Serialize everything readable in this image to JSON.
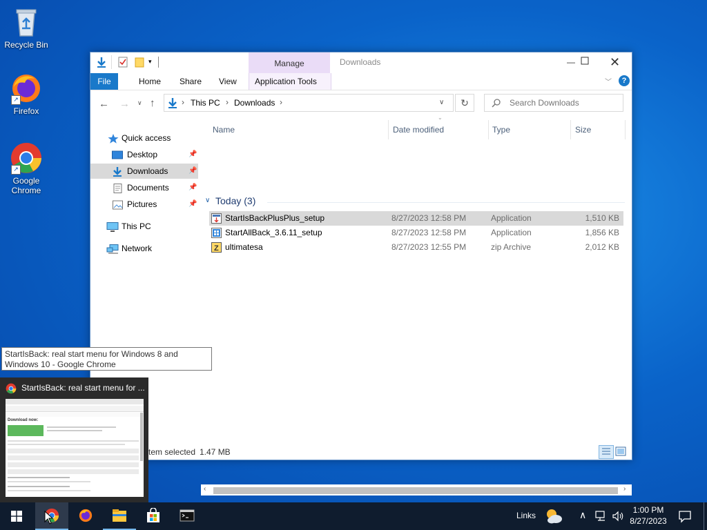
{
  "desktop": {
    "icons": [
      {
        "label": "Recycle Bin"
      },
      {
        "label": "Firefox"
      },
      {
        "label": "Google Chrome"
      }
    ]
  },
  "explorer": {
    "title": "Downloads",
    "ribbon": {
      "file": "File",
      "home": "Home",
      "share": "Share",
      "view": "View",
      "contextual_group": "Manage",
      "contextual_tab": "Application Tools"
    },
    "address": {
      "crumbs": [
        "This PC",
        "Downloads"
      ],
      "search_placeholder": "Search Downloads"
    },
    "nav": {
      "quick_access": "Quick access",
      "items": [
        {
          "label": "Desktop",
          "pinned": true
        },
        {
          "label": "Downloads",
          "pinned": true
        },
        {
          "label": "Documents",
          "pinned": true
        },
        {
          "label": "Pictures",
          "pinned": true
        }
      ],
      "this_pc": "This PC",
      "network": "Network"
    },
    "columns": [
      "Name",
      "Date modified",
      "Type",
      "Size"
    ],
    "group": "Today (3)",
    "files": [
      {
        "name": "StartIsBackPlusPlus_setup",
        "date": "8/27/2023 12:58 PM",
        "type": "Application",
        "size": "1,510 KB",
        "selected": true
      },
      {
        "name": "StartAllBack_3.6.11_setup",
        "date": "8/27/2023 12:58 PM",
        "type": "Application",
        "size": "1,856 KB",
        "selected": false
      },
      {
        "name": "ultimatesa",
        "date": "8/27/2023 12:55 PM",
        "type": "zip Archive",
        "size": "2,012 KB",
        "selected": false
      }
    ],
    "status": {
      "selected_text": "tem selected",
      "size": "1.47 MB"
    }
  },
  "chrome_preview": {
    "tooltip": "StartIsBack: real start menu for Windows 8 and Windows 10 - Google Chrome",
    "title": "StartIsBack: real start menu for ...",
    "page_heading": "Download now:"
  },
  "taskbar": {
    "links": "Links",
    "time": "1:00 PM",
    "date": "8/27/2023"
  },
  "colors": {
    "accent": "#1979ca",
    "selection": "#cce8ff",
    "manage_tab": "#eadcf7",
    "taskbar": "#0f1c2e"
  }
}
